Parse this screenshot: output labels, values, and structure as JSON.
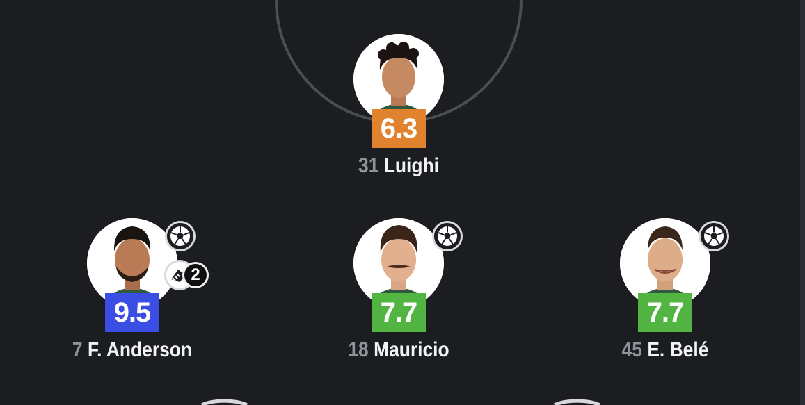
{
  "colors": {
    "background": "#1b1d21",
    "rating_orange": "#e0822e",
    "rating_green": "#52b541",
    "rating_blue": "#3a4ee4",
    "number_gray": "#8f949b",
    "name_white": "#f2f3f5"
  },
  "players": [
    {
      "number": "31",
      "name": "Luighi",
      "rating": "6.3",
      "rating_color": "#e0822e",
      "icons": []
    },
    {
      "number": "7",
      "name": "F. Anderson",
      "rating": "9.5",
      "rating_color": "#3a4ee4",
      "icons": [
        "ball-icon",
        "boot-assist-icon"
      ],
      "assist_count": "2"
    },
    {
      "number": "18",
      "name": "Mauricio",
      "rating": "7.7",
      "rating_color": "#52b541",
      "icons": [
        "ball-icon"
      ]
    },
    {
      "number": "45",
      "name": "E. Belé",
      "rating": "7.7",
      "rating_color": "#52b541",
      "icons": [
        "ball-icon"
      ]
    }
  ]
}
